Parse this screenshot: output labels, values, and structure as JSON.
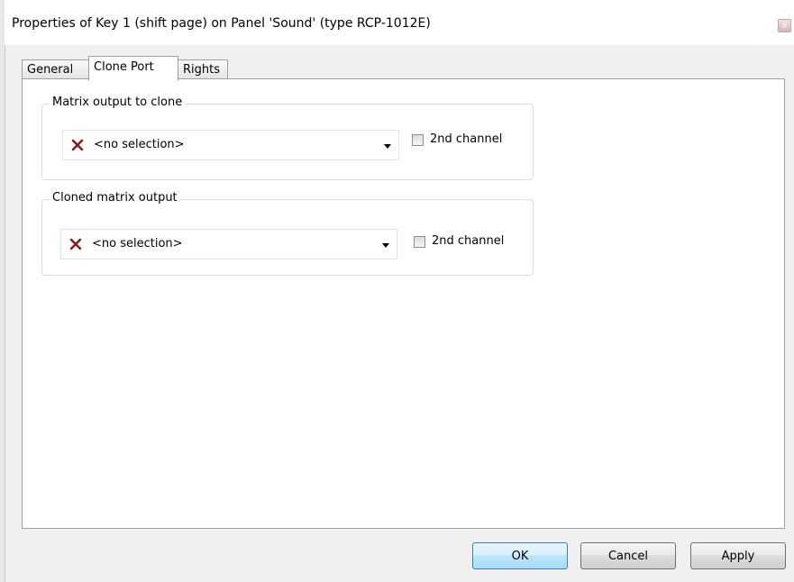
{
  "window": {
    "title": "Properties of Key 1 (shift page) on Panel 'Sound' (type RCP-1012E)",
    "close_glyph": "x"
  },
  "tabs": [
    {
      "label": "General"
    },
    {
      "label": "Clone Port"
    },
    {
      "label": "Rights"
    }
  ],
  "active_tab": "Clone Port",
  "groups": {
    "matrix_output": {
      "title": "Matrix output to clone",
      "selection": "<no selection>",
      "checkbox_label": "2nd channel",
      "checked": false
    },
    "cloned_output": {
      "title": "Cloned matrix output",
      "selection": "<no selection>",
      "checkbox_label": "2nd channel",
      "checked": false
    }
  },
  "buttons": {
    "ok": "OK",
    "cancel": "Cancel",
    "apply": "Apply"
  },
  "icons": {
    "invalid_selection": "x-mark-icon",
    "dropdown": "chevron-down-icon"
  },
  "colors": {
    "x_mark": "#8b1a1a",
    "default_button_border": "#3c7fb1"
  }
}
